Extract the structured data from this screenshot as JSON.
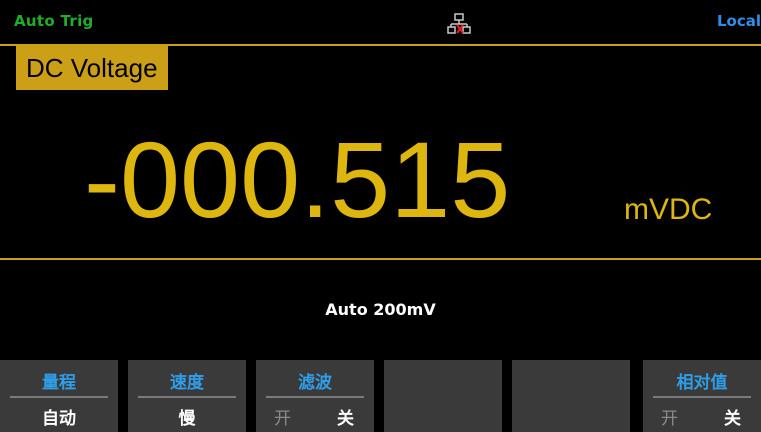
{
  "status": {
    "trigger": "Auto Trig",
    "remote": "Local",
    "network_icon": "network-disconnected-icon"
  },
  "measurement": {
    "mode": "DC Voltage",
    "reading": "-000.515",
    "unit": "mVDC",
    "range_info": "Auto 200mV"
  },
  "softkeys": [
    {
      "title": "量程",
      "value": "自动"
    },
    {
      "title": "速度",
      "value": "慢"
    },
    {
      "title": "滤波",
      "option_left": "开",
      "option_right": "关"
    },
    {
      "title": "",
      "value": ""
    },
    {
      "title": "",
      "value": ""
    },
    {
      "title": "相对值",
      "option_left": "开",
      "option_right": "关"
    }
  ],
  "colors": {
    "accent": "#ddb70f",
    "status_green": "#1fae2a",
    "status_blue": "#2f8ee8",
    "softkey_title": "#2f9ee8",
    "network_x": "#e02020"
  }
}
